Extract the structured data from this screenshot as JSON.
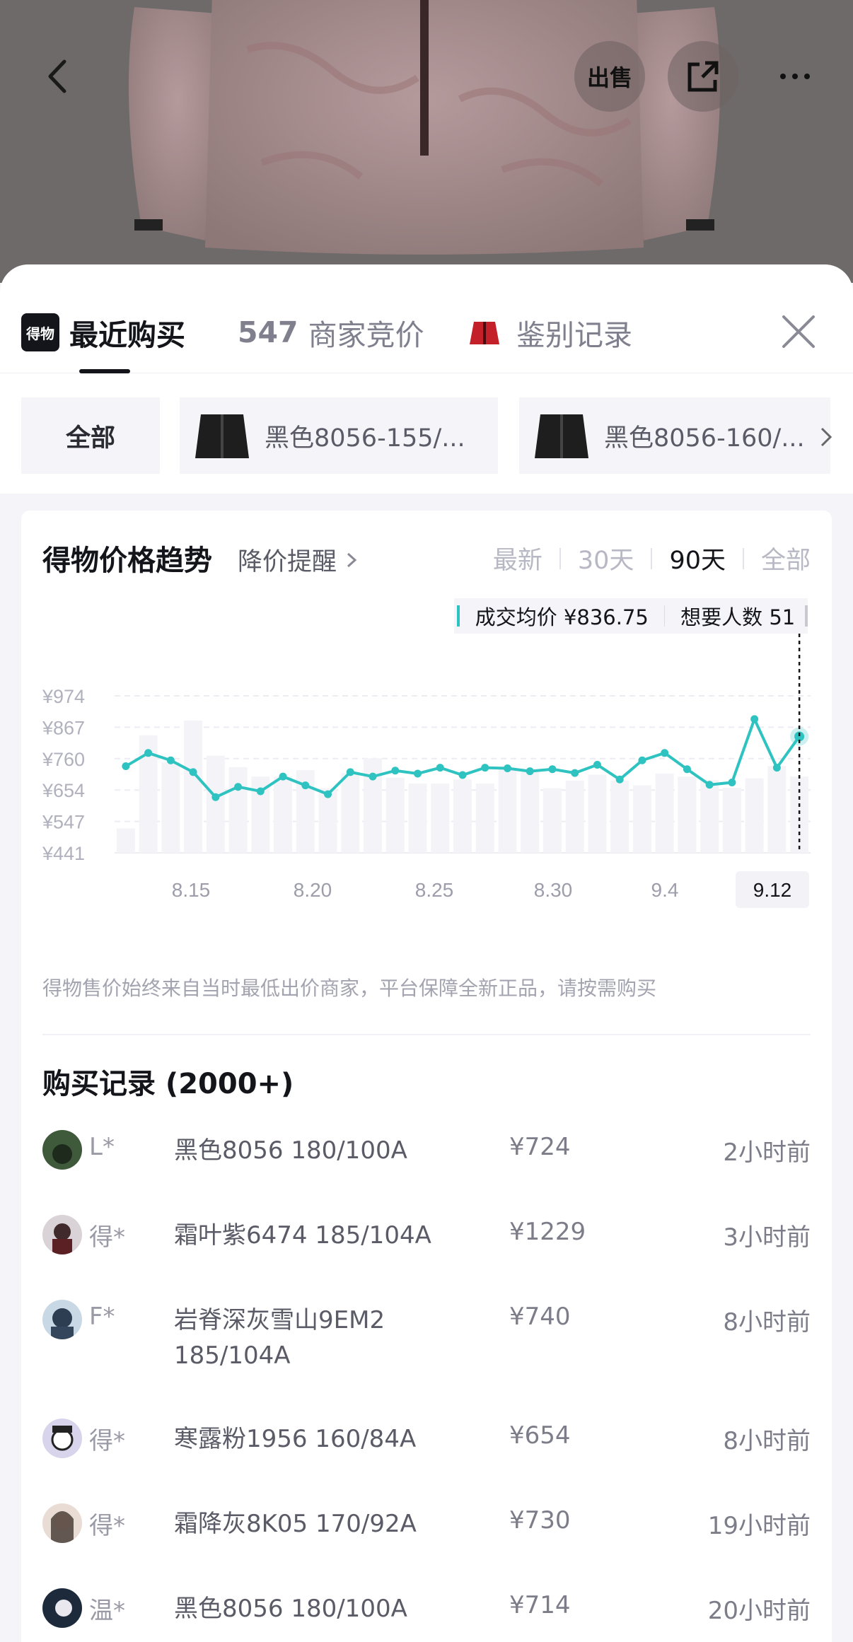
{
  "header": {
    "sell_label": "出售"
  },
  "tabs": {
    "logo_text": "得物",
    "recent_purchase": "最近购买",
    "bid_count": "547",
    "bid_label": "商家竞价",
    "auth_label": "鉴别记录"
  },
  "filters": {
    "all_label": "全部",
    "chip1": "黑色8056-155/...",
    "chip2": "黑色8056-160/..."
  },
  "trend": {
    "title": "得物价格趋势",
    "price_drop_link": "降价提醒",
    "ranges": [
      "最新",
      "30天",
      "90天",
      "全部"
    ],
    "active_range": "90天",
    "avg_price": "成交均价 ¥836.75",
    "wanted": "想要人数 51",
    "note": "得物售价始终来自当时最低出价商家，平台保障全新正品，请按需购买"
  },
  "chart_data": {
    "type": "line",
    "title": "得物价格趋势",
    "y_tick_labels": [
      "¥974",
      "¥867",
      "¥760",
      "¥654",
      "¥547",
      "¥441"
    ],
    "ylim": [
      441,
      974
    ],
    "x_tick_labels": [
      "8.15",
      "8.20",
      "8.25",
      "8.30",
      "9.4",
      "9.12"
    ],
    "selected_x": "9.12",
    "grid": true,
    "series": [
      {
        "values": [
          735,
          780,
          755,
          715,
          630,
          665,
          650,
          700,
          670,
          640,
          715,
          700,
          720,
          710,
          730,
          705,
          730,
          728,
          718,
          725,
          712,
          740,
          690,
          755,
          780,
          725,
          672,
          680,
          895,
          730,
          836
        ]
      }
    ],
    "bars": [
      524,
      840,
      748,
      890,
      771,
      732,
      700,
      700,
      722,
      660,
      712,
      762,
      696,
      676,
      676,
      690,
      676,
      728,
      716,
      660,
      686,
      706,
      686,
      670,
      710,
      700,
      688,
      662,
      694,
      736,
      700
    ]
  },
  "records": {
    "title": "购买记录 (2000+)",
    "rows": [
      {
        "user": "L*",
        "spec": "黑色8056 180/100A",
        "price": "¥724",
        "time": "2小时前"
      },
      {
        "user": "得*",
        "spec": "霜叶紫6474 185/104A",
        "price": "¥1229",
        "time": "3小时前"
      },
      {
        "user": "F*",
        "spec": "岩脊深灰雪山9EM2 185/104A",
        "price": "¥740",
        "time": "8小时前"
      },
      {
        "user": "得*",
        "spec": "寒露粉1956 160/84A",
        "price": "¥654",
        "time": "8小时前"
      },
      {
        "user": "得*",
        "spec": "霜降灰8K05 170/92A",
        "price": "¥730",
        "time": "19小时前"
      },
      {
        "user": "温*",
        "spec": "黑色8056 180/100A",
        "price": "¥714",
        "time": "20小时前"
      }
    ]
  },
  "colors": {
    "line": "#2ec3c0",
    "bar": "#f4f4f8",
    "text_primary": "#14151a",
    "text_secondary": "#7d7d8a"
  }
}
